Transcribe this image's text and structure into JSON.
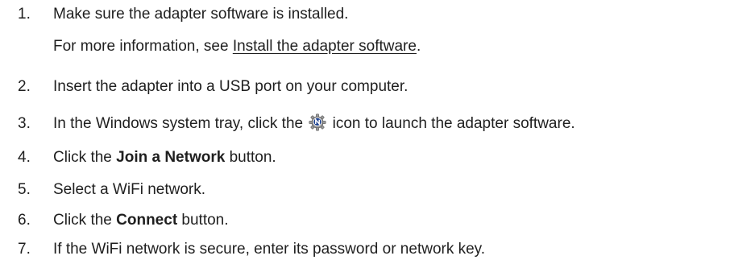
{
  "steps": [
    {
      "number": "1.",
      "text": "Make sure the adapter software is installed.",
      "note_prefix": "For more information, see ",
      "note_link": "Install the adapter software",
      "note_suffix": "."
    },
    {
      "number": "2.",
      "text": "Insert the adapter into a USB port on your computer."
    },
    {
      "number": "3.",
      "text_before": "In the Windows system tray, click the ",
      "icon": "netgear-adapter-icon",
      "text_after": " icon to launch the adapter software."
    },
    {
      "number": "4.",
      "text_before": "Click the ",
      "bold": "Join a Network",
      "text_after": " button."
    },
    {
      "number": "5.",
      "text": "Select a WiFi network."
    },
    {
      "number": "6.",
      "text_before": "Click the ",
      "bold": "Connect",
      "text_after": " button."
    },
    {
      "number": "7.",
      "text": "If the WiFi network is secure, enter its password or network key."
    }
  ],
  "colors": {
    "text": "#1f1f1f",
    "icon_badge": "#1a3f8f"
  }
}
